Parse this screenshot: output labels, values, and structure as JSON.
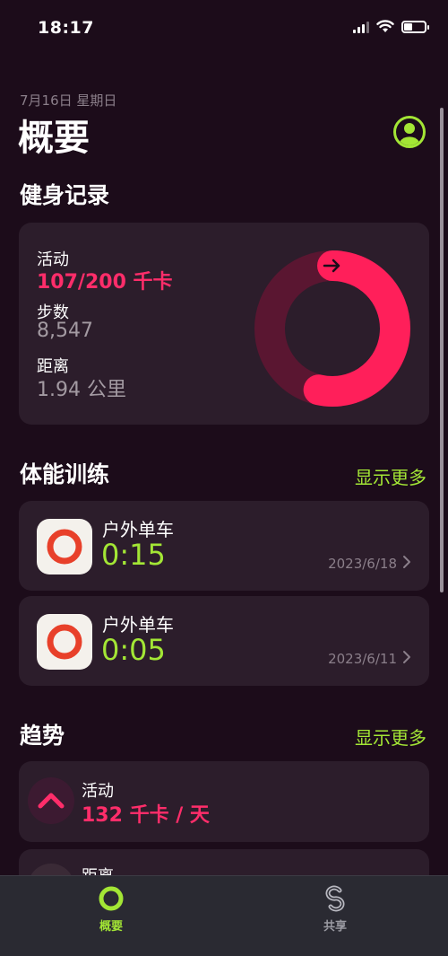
{
  "status_bar": {
    "time": "18:17"
  },
  "header": {
    "date": "7月16日 星期日",
    "title": "概要"
  },
  "fitness": {
    "section_title": "健身记录",
    "activity": {
      "label": "活动",
      "value": "107/200 千卡",
      "progress": 0.535
    },
    "steps": {
      "label": "步数",
      "value": "8,547"
    },
    "distance": {
      "label": "距离",
      "value": "1.94 公里"
    }
  },
  "workouts": {
    "section_title": "体能训练",
    "show_more": "显示更多",
    "items": [
      {
        "name": "户外单车",
        "duration": "0:15",
        "date": "2023/6/18",
        "icon": "outdoor-cycle-icon"
      },
      {
        "name": "户外单车",
        "duration": "0:05",
        "date": "2023/6/11",
        "icon": "outdoor-cycle-icon"
      }
    ]
  },
  "trends": {
    "section_title": "趋势",
    "show_more": "显示更多",
    "items": [
      {
        "label": "活动",
        "value": "132 千卡 / 天",
        "icon": "trend-up-icon"
      },
      {
        "label": "距离"
      }
    ]
  },
  "tab_bar": {
    "summary": {
      "label": "概要",
      "icon": "activity-ring-icon"
    },
    "sharing": {
      "label": "共享",
      "icon": "sharing-icon"
    }
  },
  "colors": {
    "background": "#1c0c1a",
    "card": "#2c1d2b",
    "move": "#ff2d6a",
    "accent_green": "#a3e635",
    "workout_icon_ring": "#e8402a"
  }
}
